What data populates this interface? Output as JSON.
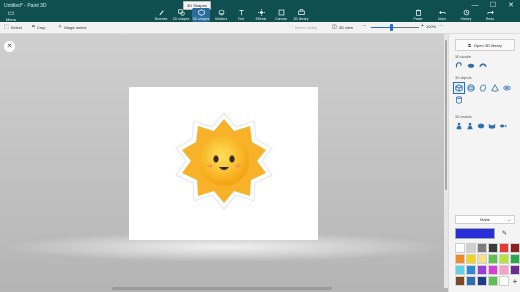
{
  "window": {
    "title": "Untitled* - Paint 3D",
    "controls": [
      "—",
      "☐",
      "✕"
    ]
  },
  "menu": {
    "label": "Menu",
    "icon": "folder-icon"
  },
  "tooltip": "3D Shapes",
  "tools": [
    {
      "label": "Brushes",
      "icon": "brush-icon",
      "color": "#ffffff"
    },
    {
      "label": "2D shapes",
      "icon": "2d-shapes-icon",
      "color": "#ffffff"
    },
    {
      "label": "3D shapes",
      "icon": "3d-shapes-icon",
      "color": "#ffffff",
      "active": true
    },
    {
      "label": "Stickers",
      "icon": "stickers-icon",
      "color": "#ffffff"
    },
    {
      "label": "Text",
      "icon": "text-icon",
      "color": "#ffffff"
    },
    {
      "label": "Effects",
      "icon": "effects-icon",
      "color": "#ffffff"
    },
    {
      "label": "Canvas",
      "icon": "canvas-icon",
      "color": "#ffffff"
    },
    {
      "label": "3D library",
      "icon": "3d-library-icon",
      "color": "#ffffff"
    }
  ],
  "right_tools": [
    {
      "label": "Paste",
      "icon": "paste-icon"
    },
    {
      "label": "Undo",
      "icon": "undo-icon"
    },
    {
      "label": "History",
      "icon": "history-icon"
    },
    {
      "label": "Redo",
      "icon": "redo-icon"
    }
  ],
  "subbar": {
    "select": "Select",
    "crop": "Crop",
    "magic_select": "Magic select",
    "mixed_reality": "Mixed reality",
    "view_3d": "3D view",
    "zoom": "100%",
    "zoom_fraction": 0.42
  },
  "panel": {
    "open_library": "Open 3D library",
    "sections": [
      {
        "title": "3D doodle",
        "shapes": [
          "sharp-doodle-icon",
          "soft-doodle-icon",
          "tube-doodle-icon"
        ]
      },
      {
        "title": "3D objects",
        "shapes": [
          "cube-icon",
          "sphere-icon",
          "capsule-icon",
          "cone-icon",
          "torus-icon",
          "cylinder-icon"
        ]
      },
      {
        "title": "3D models",
        "shapes": [
          "man-icon",
          "woman-icon",
          "dog-icon",
          "cat-icon",
          "fish-icon"
        ]
      }
    ],
    "selected_shape": "cube-icon",
    "finish": "Matte",
    "current_color": "#2a2ed9",
    "palette": [
      "#ffffff",
      "#cfcfcf",
      "#7d7d7d",
      "#3b3b3b",
      "#e53935",
      "#8e1f1f",
      "#f08a24",
      "#f5d21d",
      "#f6e08a",
      "#5ec14d",
      "#b6e23a",
      "#2aa84a",
      "#5fd3e5",
      "#2f88d8",
      "#9a3fd6",
      "#d93fd0",
      "#f2a3c7",
      "#6c2a8f",
      "#7a4a25",
      "#2f6fb1",
      "#1d3c8a",
      "#5ec14d",
      "#ffffff",
      "add"
    ]
  }
}
